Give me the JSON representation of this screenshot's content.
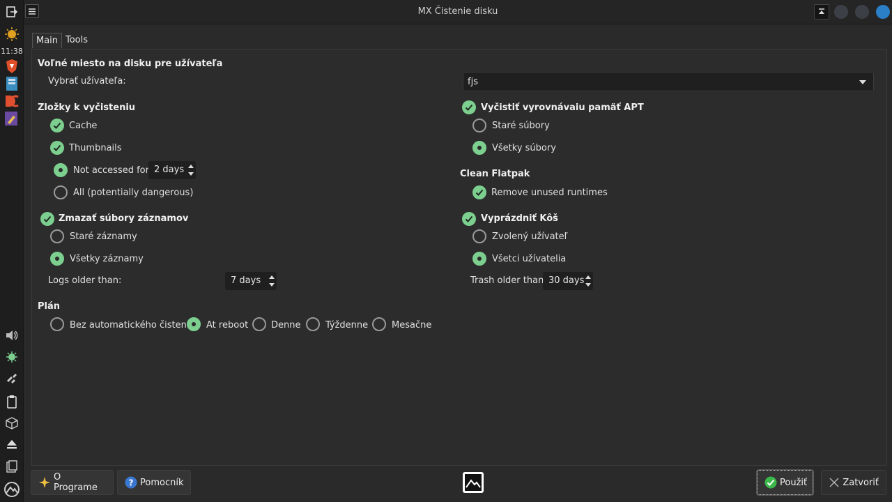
{
  "window": {
    "title": "MX Čistenie disku"
  },
  "panel": {
    "clock": "11:38"
  },
  "tabs": [
    {
      "label": "Main"
    },
    {
      "label": "Tools"
    }
  ],
  "user_section": {
    "title": "Voľné miesto na disku pre užívateľa",
    "select_label": "Vybrať užívateľa:",
    "selected_user": "fjs"
  },
  "folders": {
    "title": "Zložky k vyčisteniu",
    "cache": "Cache",
    "thumbnails": "Thumbnails",
    "not_accessed": "Not accessed for:",
    "not_accessed_value": "2 days",
    "all": "All (potentially dangerous)"
  },
  "logs": {
    "title": "Zmazať súbory záznamov",
    "old": "Staré záznamy",
    "all": "Všetky záznamy",
    "older_label": "Logs older than:",
    "older_value": "7 days"
  },
  "apt": {
    "title": "Vyčistiť vyrovnávaiu pamäť APT",
    "old": "Staré súbory",
    "all": "Všetky súbory"
  },
  "flatpak": {
    "title": "Clean Flatpak",
    "remove": "Remove unused runtimes"
  },
  "trash": {
    "title": "Vyprázdniť Kôš",
    "selected": "Zvolený užívateľ",
    "all": "Všetci užívatelia",
    "older_label": "Trash older than:",
    "older_value": "30 days"
  },
  "plan": {
    "title": "Plán",
    "options": [
      "Bez automatického čistenia",
      "At reboot",
      "Denne",
      "Týždenne",
      "Mesačne"
    ],
    "selected_index": 1
  },
  "footer": {
    "about": "O Programe",
    "help": "Pomocník",
    "apply": "Použiť",
    "close": "Zatvoriť"
  },
  "colors": {
    "accent": "#7ccf8e",
    "bg": "#2a2a2a"
  }
}
